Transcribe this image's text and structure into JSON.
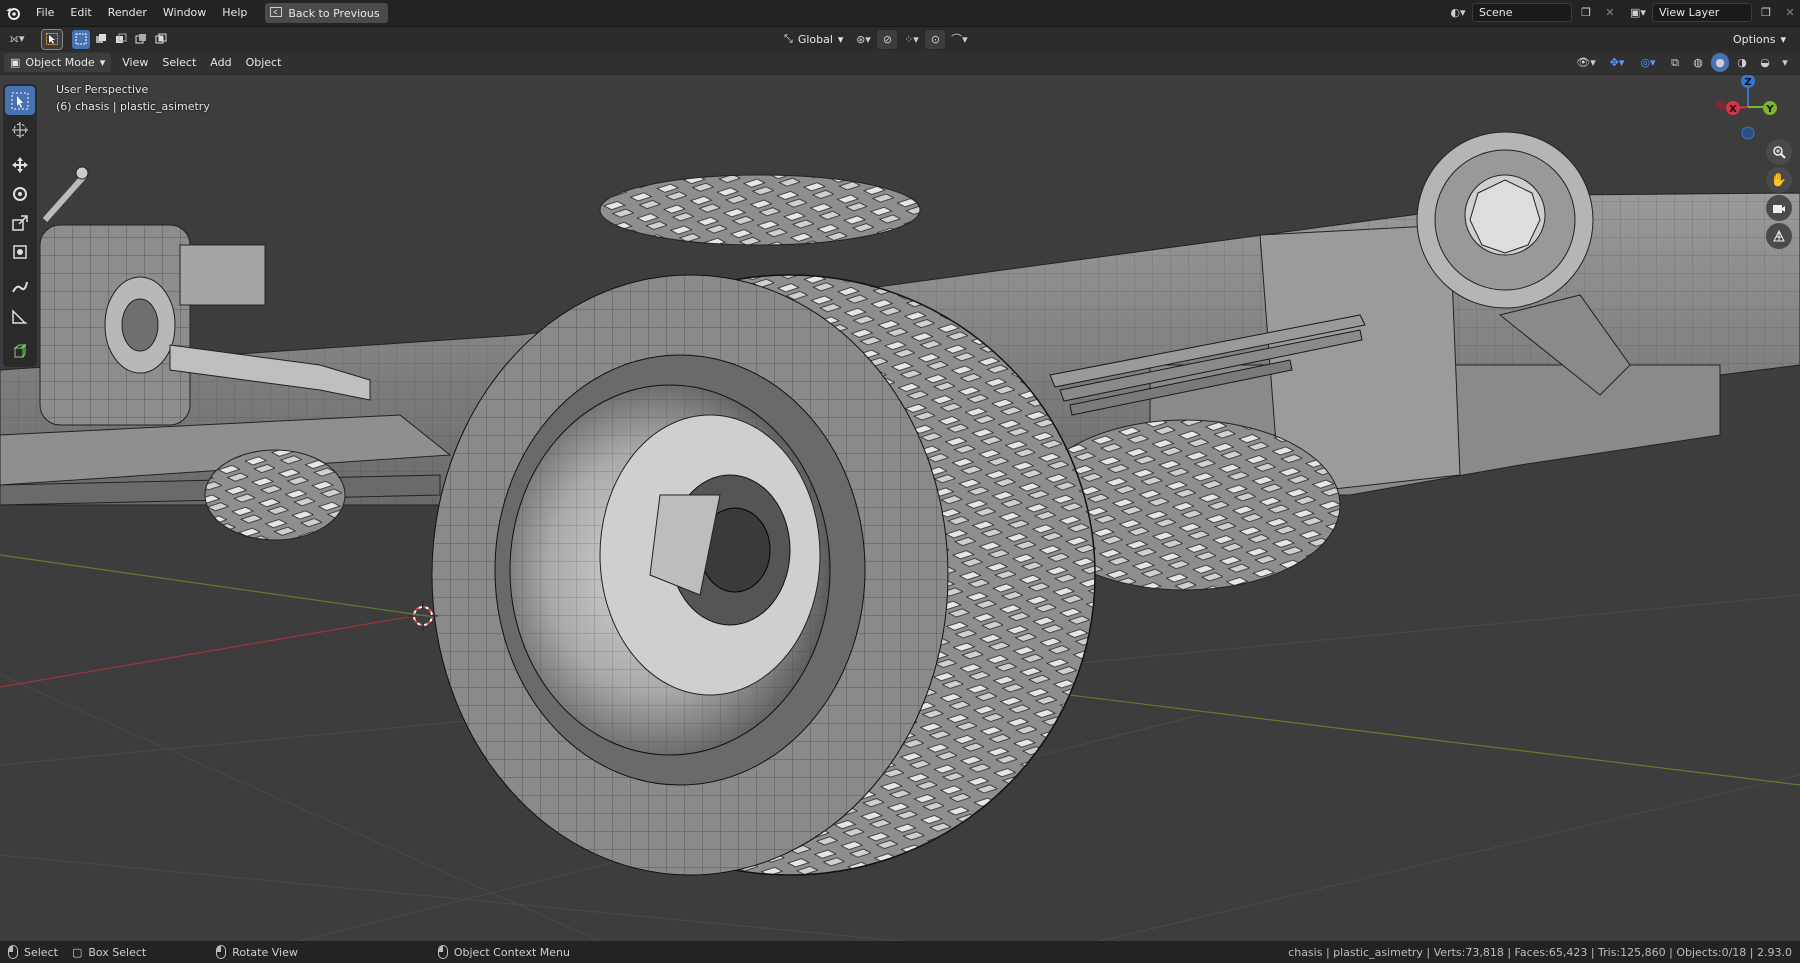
{
  "menu": {
    "file": "File",
    "edit": "Edit",
    "render": "Render",
    "window": "Window",
    "help": "Help"
  },
  "back_button": "Back to Previous",
  "scene": {
    "value": "Scene"
  },
  "view_layer": {
    "value": "View Layer"
  },
  "toolbar": {
    "orientation": "Global",
    "options": "Options"
  },
  "header": {
    "mode": "Object Mode",
    "view": "View",
    "select": "Select",
    "add": "Add",
    "object": "Object"
  },
  "viewport": {
    "perspective": "User Perspective",
    "object_info": "(6) chasis | plastic_asimetry"
  },
  "gizmo": {
    "z": "Z",
    "x": "X",
    "y": "Y"
  },
  "status": {
    "select": "Select",
    "box_select": "Box Select",
    "rotate_view": "Rotate View",
    "context_menu": "Object Context Menu",
    "stats": "chasis | plastic_asimetry | Verts:73,818 | Faces:65,423 | Tris:125,860 | Objects:0/18 | 2.93.0"
  },
  "colors": {
    "accent": "#4772b3",
    "x_axis": "#d8324a",
    "y_axis": "#7fb52b",
    "z_axis": "#2f78d8"
  }
}
